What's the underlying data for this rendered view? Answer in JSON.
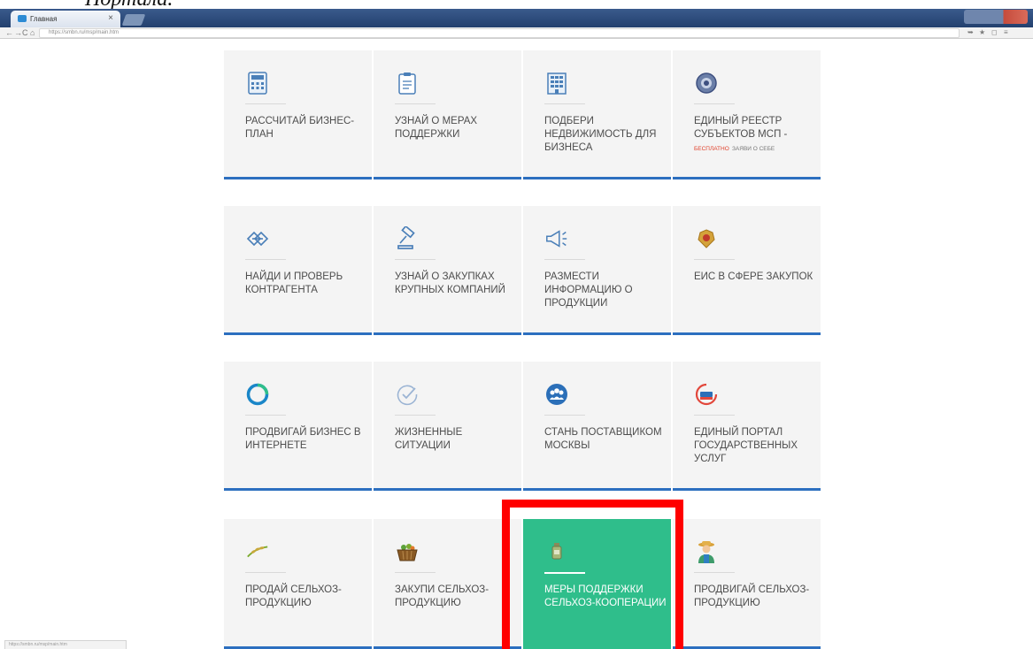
{
  "doc_caption": "Портала.",
  "browser": {
    "tab_title": "Главная",
    "tab_close": "×",
    "url": "https://smbn.ru/msp/main.htm",
    "nav": {
      "back": "←",
      "forward": "→",
      "reload": "C",
      "home": "⌂"
    },
    "toolbar_icons": {
      "arrow": "➥",
      "star": "★",
      "square": "◻",
      "menu": "≡"
    }
  },
  "status_url": "https://smbn.ru/msp/main.htm",
  "tiles": [
    {
      "label": "РАССЧИТАЙ БИЗНЕС-ПЛАН",
      "icon": "calculator-icon"
    },
    {
      "label": "УЗНАЙ О МЕРАХ ПОДДЕРЖКИ",
      "icon": "clipboard-icon"
    },
    {
      "label": "ПОДБЕРИ НЕДВИЖИМОСТЬ ДЛЯ БИЗНЕСА",
      "icon": "building-icon"
    },
    {
      "label": "ЕДИНЫЙ РЕЕСТР СУБЪЕКТОВ МСП -",
      "note_red": "БЕСПЛАТНО",
      "note": "ЗАЯВИ О СЕБЕ",
      "icon": "registry-seal-icon"
    },
    {
      "label": "НАЙДИ И ПРОВЕРЬ КОНТРАГЕНТА",
      "icon": "handshake-icon"
    },
    {
      "label": "УЗНАЙ О ЗАКУПКАХ КРУПНЫХ КОМПАНИЙ",
      "icon": "gavel-icon"
    },
    {
      "label": "РАЗМЕСТИ ИНФОРМАЦИЮ О ПРОДУКЦИИ",
      "icon": "megaphone-icon"
    },
    {
      "label": "ЕИС В СФЕРЕ ЗАКУПОК",
      "icon": "coat-of-arms-icon"
    },
    {
      "label": "ПРОДВИГАЙ БИЗНЕС В ИНТЕРНЕТЕ",
      "icon": "ring-logo-icon"
    },
    {
      "label": "ЖИЗНЕННЫЕ СИТУАЦИИ",
      "icon": "check-circle-icon"
    },
    {
      "label": "СТАНЬ ПОСТАВЩИКОМ МОСКВЫ",
      "icon": "people-group-icon"
    },
    {
      "label": "ЕДИНЫЙ ПОРТАЛ ГОСУДАРСТВЕННЫХ УСЛУГ",
      "icon": "gosuslugi-icon"
    },
    {
      "label": "ПРОДАЙ СЕЛЬХОЗ-ПРОДУКЦИЮ",
      "icon": "wheat-icon"
    },
    {
      "label": "ЗАКУПИ СЕЛЬХОЗ-ПРОДУКЦИЮ",
      "icon": "basket-icon"
    },
    {
      "label": "МЕРЫ ПОДДЕРЖКИ СЕЛЬХОЗ-КООПЕРАЦИИ",
      "icon": "bottle-icon"
    },
    {
      "label": "ПРОДВИГАЙ СЕЛЬХОЗ-ПРОДУКЦИЮ",
      "icon": "farmer-icon"
    }
  ]
}
